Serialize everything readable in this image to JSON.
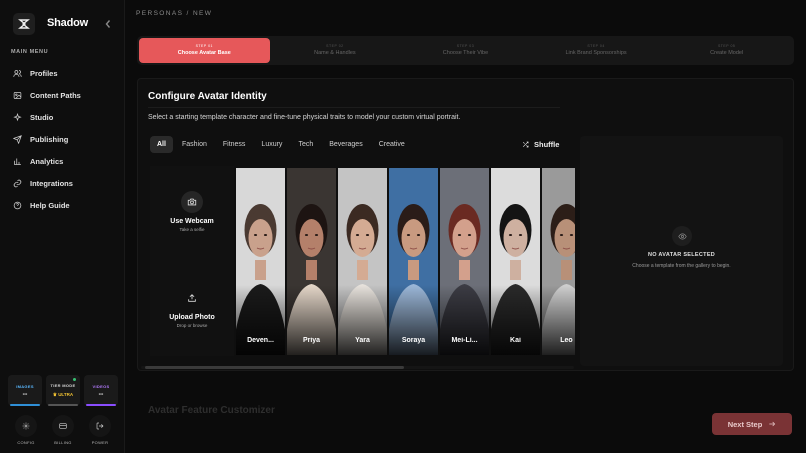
{
  "app": {
    "name": "Shadow"
  },
  "sidebar": {
    "menu_label": "MAIN MENU",
    "items": [
      {
        "label": "Profiles",
        "icon": "users-icon"
      },
      {
        "label": "Content Paths",
        "icon": "image-icon"
      },
      {
        "label": "Studio",
        "icon": "sparkle-icon"
      },
      {
        "label": "Publishing",
        "icon": "send-icon"
      },
      {
        "label": "Analytics",
        "icon": "bar-chart-icon"
      },
      {
        "label": "Integrations",
        "icon": "link-icon"
      },
      {
        "label": "Help Guide",
        "icon": "help-icon"
      }
    ],
    "stats": {
      "images": {
        "label": "IMAGES",
        "value": "--"
      },
      "tier": {
        "label": "TIER MODE",
        "value": "ULTRA"
      },
      "videos": {
        "label": "VIDEOS",
        "value": "--"
      }
    },
    "actions": [
      {
        "label": "CONFIG"
      },
      {
        "label": "BILLING"
      },
      {
        "label": "POWER"
      }
    ]
  },
  "breadcrumb": "PERSONAS / NEW",
  "stepper": [
    {
      "num": "STEP 01",
      "title": "Choose Avatar Base",
      "active": true
    },
    {
      "num": "STEP 02",
      "title": "Name & Handles",
      "active": false
    },
    {
      "num": "STEP 03",
      "title": "Choose Their Vibe",
      "active": false
    },
    {
      "num": "STEP 04",
      "title": "Link Brand Sponsorships",
      "active": false
    },
    {
      "num": "STEP 05",
      "title": "Create Model",
      "active": false
    }
  ],
  "identity": {
    "title": "Configure Avatar Identity",
    "subtitle": "Select a starting template character and fine-tune physical traits to model your custom virtual portrait.",
    "filters": [
      "All",
      "Fashion",
      "Fitness",
      "Luxury",
      "Tech",
      "Beverages",
      "Creative"
    ],
    "active_filter": "All",
    "shuffle_label": "Shuffle",
    "webcam": {
      "title": "Use Webcam",
      "sub": "Take a selfie"
    },
    "upload": {
      "title": "Upload Photo",
      "sub": "Drop or browse"
    },
    "avatars": [
      {
        "name": "Deven...",
        "skin": "#c9a18c",
        "hair": "#4a3a32",
        "bg": "#d8d8d8",
        "shirt": "#1b1b1b"
      },
      {
        "name": "Priya",
        "skin": "#b4806a",
        "hair": "#1d1412",
        "bg": "#3a3532",
        "shirt": "#e4d6c8"
      },
      {
        "name": "Yara",
        "skin": "#d4ab93",
        "hair": "#3b2a22",
        "bg": "#c4c4c4",
        "shirt": "#e7e2dc"
      },
      {
        "name": "Soraya",
        "skin": "#c89a80",
        "hair": "#2a1c18",
        "bg": "#3f6fa3",
        "shirt": "#9bb7d8"
      },
      {
        "name": "Mei-Li...",
        "skin": "#d3a08c",
        "hair": "#6a2a22",
        "bg": "#6c6f78",
        "shirt": "#3c3c44"
      },
      {
        "name": "Kai",
        "skin": "#ceb0a0",
        "hair": "#141414",
        "bg": "#dcdcdc",
        "shirt": "#2a2a2a"
      },
      {
        "name": "Leo",
        "skin": "#b89078",
        "hair": "#2c1e18",
        "bg": "#9a9a9a",
        "shirt": "#cfcfcf"
      }
    ]
  },
  "preview": {
    "title": "NO AVATAR SELECTED",
    "subtitle": "Choose a template from the gallery to begin."
  },
  "section2_title": "Avatar Feature Customizer",
  "next_label": "Next Step",
  "colors": {
    "accent": "#e6585a",
    "next_bg": "#7a3335",
    "bg": "#0b0b0b"
  }
}
